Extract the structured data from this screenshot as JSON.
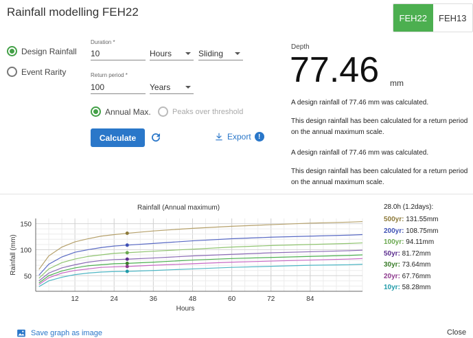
{
  "header": {
    "title": "Rainfall modelling FEH22"
  },
  "toggle": {
    "active": "FEH22",
    "inactive": "FEH13"
  },
  "mode": {
    "design": "Design Rainfall",
    "rarity": "Event Rarity"
  },
  "duration": {
    "label": "Duration *",
    "value": "10",
    "unit": "Hours",
    "window": "Sliding"
  },
  "return_period": {
    "label": "Return period *",
    "value": "100",
    "unit": "Years"
  },
  "series_type": {
    "annual": "Annual Max.",
    "pot": "Peaks over threshold"
  },
  "actions": {
    "calculate": "Calculate",
    "export": "Export",
    "info": "!"
  },
  "result": {
    "depth_label": "Depth",
    "depth_value": "77.46",
    "depth_unit": "mm",
    "desc1": "A design rainfall of 77.46 mm was calculated.",
    "desc2": "This design rainfall has been calculated for a return period on the annual maximum scale.",
    "desc3": "A design rainfall of 77.46 mm was calculated.",
    "desc4": "This design rainfall has been calculated for a return period on the annual maximum scale."
  },
  "legend": {
    "header": "28.0h (1.2days):",
    "items": [
      {
        "rp": "500yr:",
        "val": " 131.55mm",
        "color": "#8d7a3a"
      },
      {
        "rp": "200yr:",
        "val": " 108.75mm",
        "color": "#3f51b5"
      },
      {
        "rp": "100yr:",
        "val": " 94.11mm",
        "color": "#6aa84f"
      },
      {
        "rp": "50yr:",
        "val": " 81.72mm",
        "color": "#5b2d8e"
      },
      {
        "rp": "30yr:",
        "val": " 73.64mm",
        "color": "#3a7d2a"
      },
      {
        "rp": "20yr:",
        "val": " 67.76mm",
        "color": "#8e3a8e"
      },
      {
        "rp": "10yr:",
        "val": " 58.28mm",
        "color": "#1f9aa8"
      }
    ]
  },
  "chart_data": {
    "type": "line",
    "title": "Rainfall (Annual maximum)",
    "xlabel": "Hours",
    "ylabel": "Rainfall (mm)",
    "xlim": [
      0,
      100
    ],
    "ylim": [
      20,
      160
    ],
    "xticks": [
      12,
      24,
      36,
      48,
      60,
      72,
      84
    ],
    "yticks": [
      50,
      100,
      150
    ],
    "grid": true,
    "marker_x": 28,
    "x": [
      1,
      4,
      8,
      12,
      16,
      20,
      24,
      28,
      36,
      48,
      60,
      72,
      84,
      96,
      100
    ],
    "series": [
      {
        "name": "500yr",
        "color": "#b5a06a",
        "values": [
          62,
          88,
          105,
          115,
          121,
          126,
          129,
          131.55,
          136,
          141,
          145,
          148,
          151,
          153,
          154
        ]
      },
      {
        "name": "200yr",
        "color": "#5869c4",
        "values": [
          51,
          72,
          86,
          95,
          100,
          104,
          107,
          108.75,
          112,
          117,
          121,
          124,
          126,
          128,
          129
        ]
      },
      {
        "name": "100yr",
        "color": "#8fc46f",
        "values": [
          45,
          63,
          75,
          82,
          87,
          90,
          93,
          94.11,
          97,
          101,
          105,
          108,
          110,
          112,
          113
        ]
      },
      {
        "name": "50yr",
        "color": "#8a6ab5",
        "values": [
          40,
          55,
          65,
          71,
          76,
          79,
          81,
          81.72,
          84,
          88,
          91,
          94,
          96,
          98,
          99
        ]
      },
      {
        "name": "30yr",
        "color": "#4caf50",
        "values": [
          36,
          50,
          59,
          65,
          69,
          71,
          73,
          73.64,
          76,
          80,
          83,
          85,
          87,
          89,
          90
        ]
      },
      {
        "name": "20yr",
        "color": "#c768c4",
        "values": [
          33,
          46,
          55,
          60,
          63,
          66,
          67,
          67.76,
          70,
          73,
          76,
          78,
          80,
          82,
          83
        ]
      },
      {
        "name": "10yr",
        "color": "#4db6c4",
        "values": [
          29,
          40,
          47,
          52,
          55,
          57,
          58,
          58.28,
          60,
          63,
          66,
          68,
          70,
          71,
          72
        ]
      }
    ],
    "marker_colors": [
      "#8d7a3a",
      "#3f51b5",
      "#6aa84f",
      "#5b2d8e",
      "#3a7d2a",
      "#8e3a8e",
      "#1f9aa8"
    ]
  },
  "footer": {
    "save": "Save graph as image",
    "close": "Close"
  }
}
